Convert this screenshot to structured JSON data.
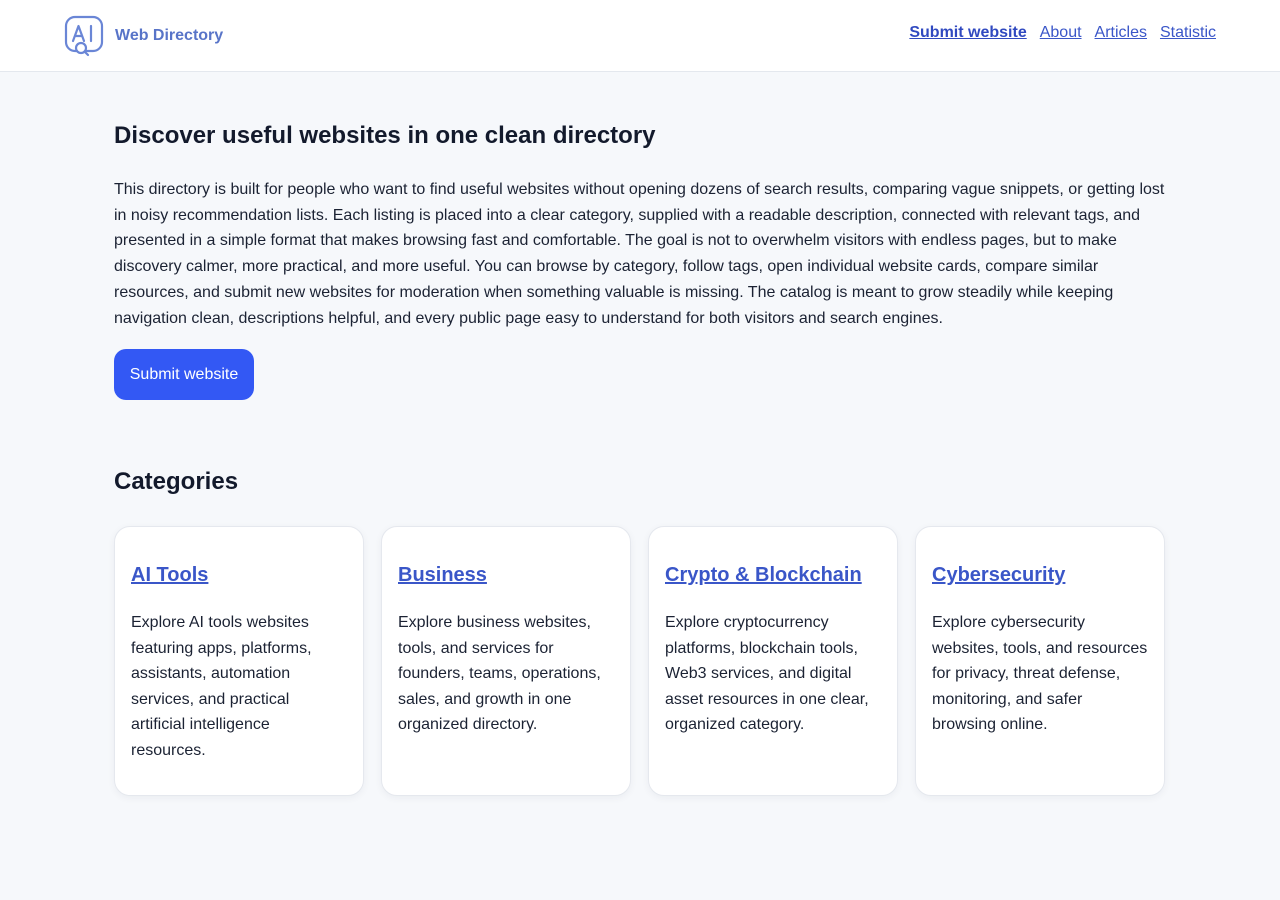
{
  "header": {
    "brand_name": "Web Directory",
    "logo_icon": "ai-search-logo-icon",
    "nav": [
      {
        "label": "Submit website"
      },
      {
        "label": "About"
      },
      {
        "label": "Articles"
      },
      {
        "label": "Statistic"
      }
    ]
  },
  "hero": {
    "title": "Discover useful websites in one clean directory",
    "description": "This directory is built for people who want to find useful websites without opening dozens of search results, comparing vague snippets, or getting lost in noisy recommendation lists. Each listing is placed into a clear category, supplied with a readable description, connected with relevant tags, and presented in a simple format that makes browsing fast and comfortable. The goal is not to overwhelm visitors with endless pages, but to make discovery calmer, more practical, and more useful. You can browse by category, follow tags, open individual website cards, compare similar resources, and submit new websites for moderation when something valuable is missing. The catalog is meant to grow steadily while keeping navigation clean, descriptions helpful, and every public page easy to understand for both visitors and search engines.",
    "button_label": "Submit website"
  },
  "categories": {
    "heading": "Categories",
    "items": [
      {
        "name": "AI Tools",
        "description": "Explore AI tools websites featuring apps, platforms, assistants, automation services, and practical artificial intelligence resources."
      },
      {
        "name": "Business",
        "description": "Explore business websites, tools, and services for founders, teams, operations, sales, and growth in one organized directory."
      },
      {
        "name": "Crypto & Blockchain",
        "description": "Explore cryptocurrency platforms, blockchain tools, Web3 services, and digital asset resources in one clear, organized category."
      },
      {
        "name": "Cybersecurity",
        "description": "Explore cybersecurity websites, tools, and resources for privacy, threat defense, monitoring, and safer browsing online."
      }
    ]
  },
  "colors": {
    "accent": "#3358f4",
    "link": "#3a56c8",
    "brand": "#5874c8",
    "background": "#f6f8fb"
  }
}
